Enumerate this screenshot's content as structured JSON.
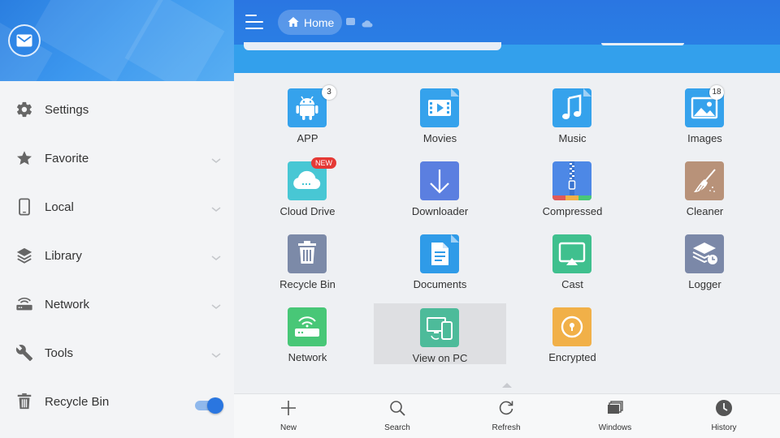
{
  "sidebar": {
    "items": [
      {
        "label": "Settings",
        "icon": "gear-icon",
        "has_chevron": false
      },
      {
        "label": "Favorite",
        "icon": "star-icon",
        "has_chevron": true
      },
      {
        "label": "Local",
        "icon": "phone-icon",
        "has_chevron": true
      },
      {
        "label": "Library",
        "icon": "layers-icon",
        "has_chevron": true
      },
      {
        "label": "Network",
        "icon": "router-icon",
        "has_chevron": true
      },
      {
        "label": "Tools",
        "icon": "wrench-icon",
        "has_chevron": true
      },
      {
        "label": "Recycle Bin",
        "icon": "trash-icon",
        "toggle_on": true
      }
    ]
  },
  "header": {
    "breadcrumb_home": "Home"
  },
  "grid": {
    "tiles": [
      {
        "label": "APP",
        "icon": "android-icon",
        "badge": "3"
      },
      {
        "label": "Movies",
        "icon": "movie-icon"
      },
      {
        "label": "Music",
        "icon": "music-note-icon"
      },
      {
        "label": "Images",
        "icon": "image-icon",
        "badge": "18"
      },
      {
        "label": "Cloud Drive",
        "icon": "cloud-icon",
        "badge_new": "NEW"
      },
      {
        "label": "Downloader",
        "icon": "download-icon"
      },
      {
        "label": "Compressed",
        "icon": "zip-icon"
      },
      {
        "label": "Cleaner",
        "icon": "broom-icon"
      },
      {
        "label": "Recycle Bin",
        "icon": "trash-icon"
      },
      {
        "label": "Documents",
        "icon": "document-icon"
      },
      {
        "label": "Cast",
        "icon": "cast-icon"
      },
      {
        "label": "Logger",
        "icon": "logger-icon"
      },
      {
        "label": "Network",
        "icon": "router-icon"
      },
      {
        "label": "View on PC",
        "icon": "pc-phone-icon",
        "selected": true
      },
      {
        "label": "Encrypted",
        "icon": "lock-icon"
      }
    ]
  },
  "bottombar": {
    "items": [
      {
        "label": "New",
        "icon": "plus-icon"
      },
      {
        "label": "Search",
        "icon": "search-icon"
      },
      {
        "label": "Refresh",
        "icon": "refresh-icon"
      },
      {
        "label": "Windows",
        "icon": "windows-icon"
      },
      {
        "label": "History",
        "icon": "clock-icon"
      }
    ]
  },
  "colors": {
    "accent": "#2a76e0",
    "header_blue": "#3c97ee",
    "app": "#35a2ec",
    "movies": "#35a2ec",
    "music": "#35a2ec",
    "images": "#35a2ec",
    "cloud": "#48c7d4",
    "downloader": "#5b7fe0",
    "compressed": "#4d88e6",
    "cleaner": "#b89279",
    "recycle": "#7c8aa8",
    "documents": "#2f9be8",
    "cast": "#3fc08e",
    "logger": "#7b88a8",
    "network": "#48c777",
    "viewpc": "#4dbb9a",
    "encrypted": "#f1b048"
  }
}
